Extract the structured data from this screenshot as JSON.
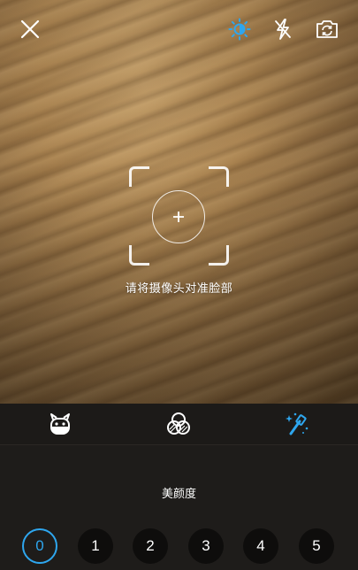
{
  "colors": {
    "accent": "#2ea6ee",
    "icon": "#ffffff",
    "panel_bg": "#1e1c1a"
  },
  "topbar": {
    "close_icon": "close-icon",
    "brightness_icon": "brightness-icon",
    "flash_icon": "flash-off-icon",
    "switch_camera_icon": "switch-camera-icon"
  },
  "camera": {
    "hint": "请将摄像头对准脸部"
  },
  "modes": [
    {
      "name": "sticker",
      "icon": "robot-face-icon",
      "active": false
    },
    {
      "name": "filter",
      "icon": "filter-circles-icon",
      "active": false
    },
    {
      "name": "beauty",
      "icon": "magic-wand-icon",
      "active": true
    }
  ],
  "beauty": {
    "label": "美颜度",
    "levels": [
      "0",
      "1",
      "2",
      "3",
      "4",
      "5"
    ],
    "selected": "0"
  }
}
